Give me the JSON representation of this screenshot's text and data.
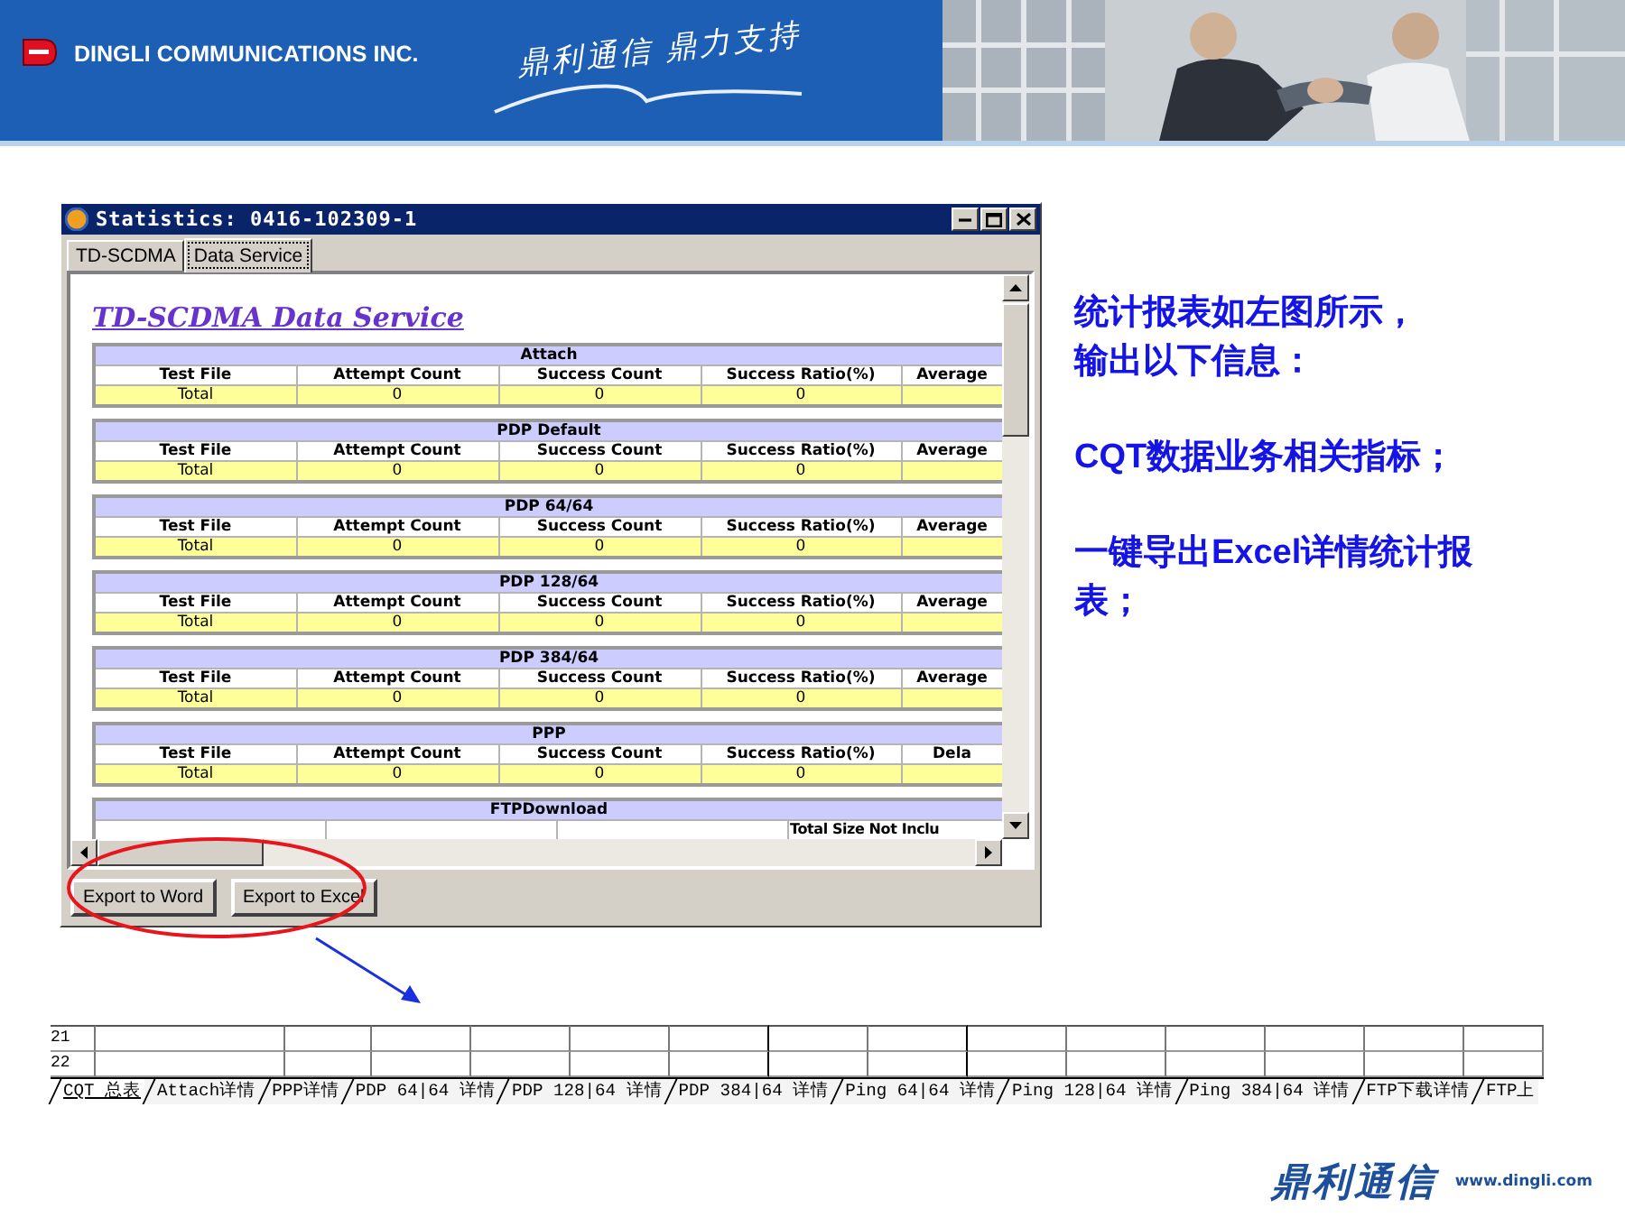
{
  "header": {
    "company": "DINGLI COMMUNICATIONS INC.",
    "slogan": "鼎利通信 鼎力支持"
  },
  "window": {
    "title": "Statistics: 0416-102309-1",
    "tabs": [
      {
        "label": "TD-SCDMA",
        "selected": false
      },
      {
        "label": "Data Service",
        "selected": true
      }
    ],
    "report_title": "TD-SCDMA Data Service",
    "sections": [
      {
        "kind": "summary",
        "name": "Attach",
        "columns": [
          "Test File",
          "Attempt Count",
          "Success Count",
          "Success Ratio(%)",
          "Average"
        ],
        "total_row": [
          "Total",
          "0",
          "0",
          "0"
        ]
      },
      {
        "kind": "summary",
        "name": "PDP Default",
        "columns": [
          "Test File",
          "Attempt Count",
          "Success Count",
          "Success Ratio(%)",
          "Average"
        ],
        "total_row": [
          "Total",
          "0",
          "0",
          "0"
        ]
      },
      {
        "kind": "summary",
        "name": "PDP 64/64",
        "columns": [
          "Test File",
          "Attempt Count",
          "Success Count",
          "Success Ratio(%)",
          "Average"
        ],
        "total_row": [
          "Total",
          "0",
          "0",
          "0"
        ]
      },
      {
        "kind": "summary",
        "name": "PDP 128/64",
        "columns": [
          "Test File",
          "Attempt Count",
          "Success Count",
          "Success Ratio(%)",
          "Average"
        ],
        "total_row": [
          "Total",
          "0",
          "0",
          "0"
        ]
      },
      {
        "kind": "summary",
        "name": "PDP 384/64",
        "columns": [
          "Test File",
          "Attempt Count",
          "Success Count",
          "Success Ratio(%)",
          "Average"
        ],
        "total_row": [
          "Total",
          "0",
          "0",
          "0"
        ]
      },
      {
        "kind": "summary",
        "name": "PPP",
        "columns": [
          "Test File",
          "Attempt Count",
          "Success Count",
          "Success Ratio(%)",
          "Dela"
        ],
        "total_row": [
          "Total",
          "0",
          "0",
          "0"
        ]
      },
      {
        "kind": "header_only",
        "name": "FTPDownload",
        "columns": [
          "Total Size Not Inclu"
        ]
      }
    ],
    "buttons": [
      "Export to Word",
      "Export to Excel"
    ]
  },
  "notes": [
    [
      "统计报表如左图所示，",
      "输出以下信息："
    ],
    [
      "CQT数据业务相关指标；"
    ],
    [
      "一键导出Excel详情统计报表；"
    ]
  ],
  "spreadsheet": {
    "row_numbers": [
      "21",
      "22"
    ],
    "sheet_tabs": [
      {
        "label": "CQT 总表",
        "selected": true
      },
      {
        "label": "Attach详情",
        "selected": false
      },
      {
        "label": "PPP详情",
        "selected": false
      },
      {
        "label": "PDP 64|64 详情",
        "selected": false
      },
      {
        "label": "PDP 128|64 详情",
        "selected": false
      },
      {
        "label": "PDP 384|64 详情",
        "selected": false
      },
      {
        "label": "Ping 64|64 详情",
        "selected": false
      },
      {
        "label": "Ping 128|64 详情",
        "selected": false
      },
      {
        "label": "Ping 384|64 详情",
        "selected": false
      },
      {
        "label": "FTP下载详情",
        "selected": false
      },
      {
        "label": "FTP上",
        "selected": false
      }
    ]
  },
  "footer": {
    "brand": "鼎利通信",
    "url": "www.dingli.com"
  }
}
